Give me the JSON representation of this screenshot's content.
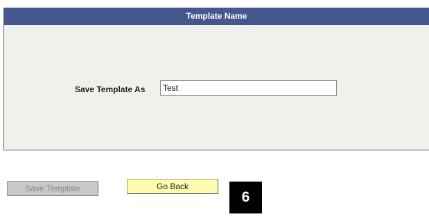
{
  "dialog": {
    "header_title": "Template Name",
    "field_label": "Save Template As",
    "field_value": "Test"
  },
  "buttons": {
    "save_template": "Save Template",
    "go_back": "Go Back"
  },
  "step_badge": "6"
}
